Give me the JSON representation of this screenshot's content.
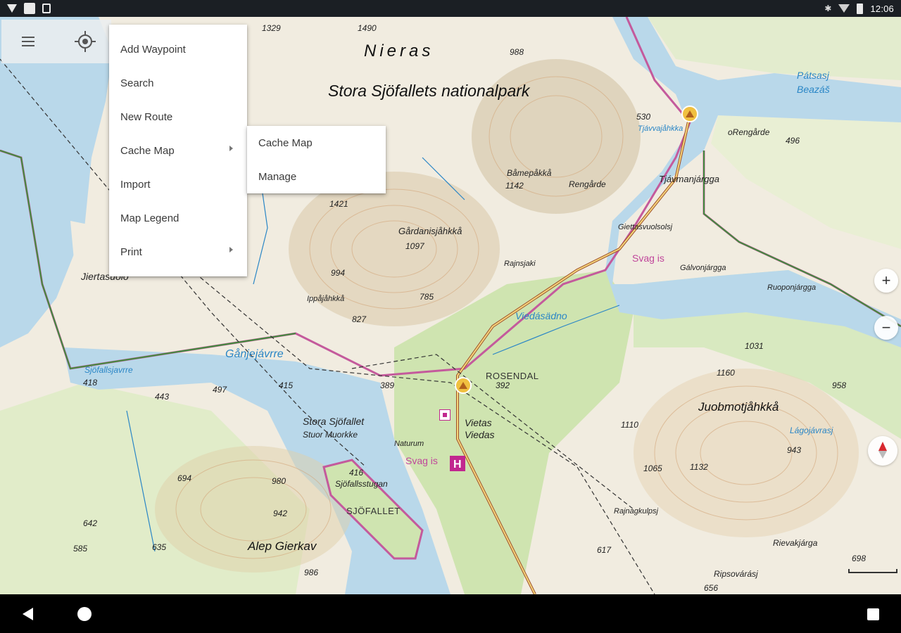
{
  "status_bar": {
    "time": "12:06",
    "left_icons": [
      "download-icon",
      "app-icon",
      "sim-icon"
    ],
    "right_icons": [
      "bluetooth-icon",
      "wifi-icon",
      "battery-icon"
    ]
  },
  "toolbar": {
    "menu_icon": "hamburger-menu-icon",
    "locate_icon": "my-location-icon"
  },
  "main_menu": {
    "items": [
      {
        "label": "Add Waypoint",
        "has_submenu": false
      },
      {
        "label": "Search",
        "has_submenu": false
      },
      {
        "label": "New Route",
        "has_submenu": false
      },
      {
        "label": "Cache Map",
        "has_submenu": true
      },
      {
        "label": "Import",
        "has_submenu": false
      },
      {
        "label": "Map Legend",
        "has_submenu": false
      },
      {
        "label": "Print",
        "has_submenu": true
      }
    ]
  },
  "sub_menu": {
    "items": [
      {
        "label": "Cache Map"
      },
      {
        "label": "Manage"
      }
    ]
  },
  "map": {
    "labels": {
      "nieras": "Nieras",
      "park": "Stora Sjöfallets nationalpark",
      "gardanisjahkka": "Gårdanisjåhkkå",
      "jiertasuolo": "Jiertasuolo",
      "ganjejavrre": "Gånjejávrre",
      "stora_sjofallet": "Stora Sjöfallet",
      "stuor_muorkke": "Stuor Muorkke",
      "vietas": "Vietas",
      "viedas": "Viedas",
      "rosendal": "ROSENDAL",
      "sjofallet": "SJÖFALLET",
      "sjofallsstugan": "Sjöfallsstugan",
      "alep_gierkav": "Alep Gierkav",
      "juobmotjahkka": "Juobmotjåhkkå",
      "patsasj": "Pátsasj",
      "beazas": "Beazáš",
      "rengarde": "Rengårde",
      "tjavmanjargga": "Tjávmanjárgga",
      "viedasatno": "Viedásädno",
      "svag_is_1": "Svag is",
      "svag_is_2": "Svag is",
      "bamepakka": "Båmepåkkå",
      "rengarde2": "oRengårde",
      "lagojavrasj": "Lágojávrasj",
      "rievakjarga": "Rievakjárga",
      "ripsovarasj": "Ripsovárásj",
      "galvonjargga": "Gálvonjárgga",
      "ruoponjargga": "Ruoponjárgga",
      "giettasvuolsolsj": "Giettasvuolsolsj",
      "ippajahkka": "Ippåjåhkkå",
      "rajnsjaki": "Rajnsjaki",
      "sjofallsjavrre": "Sjöfallsjavrre",
      "tjavvajahkka": "Tjávvajåhkka",
      "naturum": "Naturum",
      "rajnagkulpsj": "Rajnagkulpsj"
    },
    "elevations": [
      "1329",
      "1490",
      "988",
      "530",
      "496",
      "1142",
      "1421",
      "1097",
      "994",
      "785",
      "827",
      "389",
      "392",
      "418",
      "443",
      "497",
      "415",
      "416",
      "694",
      "980",
      "942",
      "642",
      "585",
      "635",
      "986",
      "1031",
      "1160",
      "958",
      "1110",
      "943",
      "1065",
      "1132",
      "617",
      "698",
      "656"
    ],
    "zoom_in": "+",
    "zoom_out": "−",
    "compass_icon": "compass-north-icon"
  },
  "nav_bar": {
    "back_icon": "back-icon",
    "home_icon": "home-icon",
    "recents_icon": "recents-icon"
  }
}
